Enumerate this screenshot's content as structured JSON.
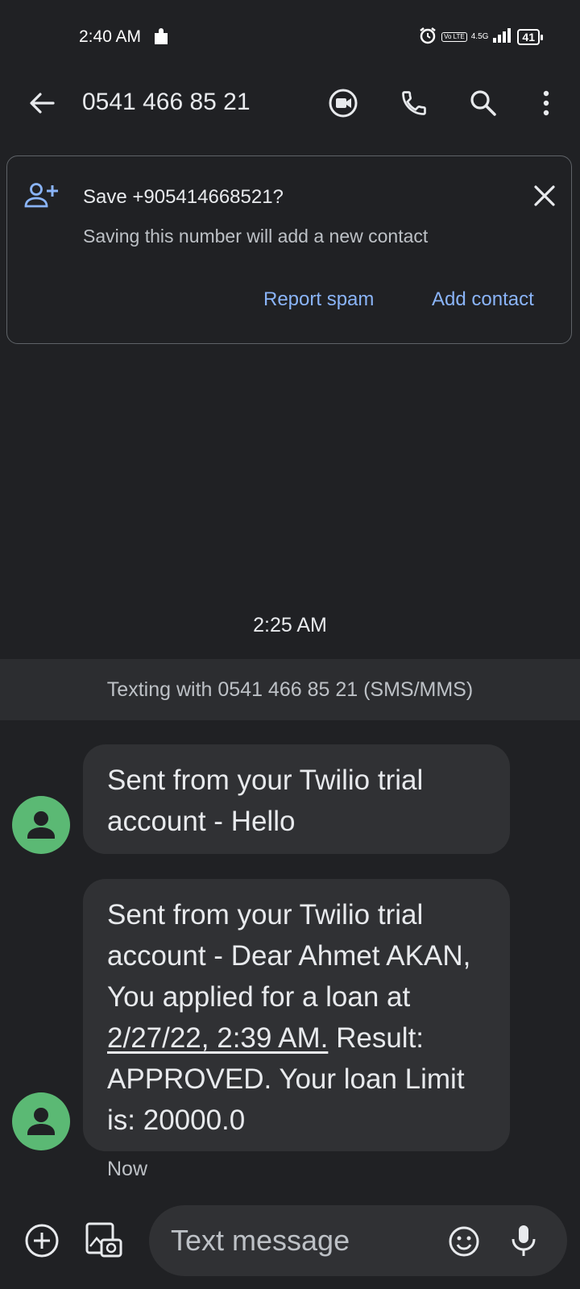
{
  "status_bar": {
    "time": "2:40 AM",
    "volte": "Vo LTE",
    "network": "4.5G",
    "battery": "41"
  },
  "app_bar": {
    "title": "0541 466 85 21"
  },
  "save_card": {
    "title": "Save +905414668521?",
    "subtitle": "Saving this number will add a new contact",
    "report_spam": "Report spam",
    "add_contact": "Add contact"
  },
  "conversation": {
    "time_header": "2:25 AM",
    "banner": "Texting with 0541 466 85 21 (SMS/MMS)",
    "messages": [
      {
        "text": "Sent from your Twilio trial account - Hello"
      },
      {
        "text_before": "Sent from your Twilio trial account - Dear Ahmet AKAN, You applied for a loan at ",
        "link": "2/27/22, 2:39 AM.",
        "text_after": " Result: APPROVED. Your loan Limit is: 20000.0"
      }
    ],
    "last_status": "Now"
  },
  "compose": {
    "placeholder": "Text message"
  },
  "colors": {
    "background": "#202124",
    "bubble": "#303134",
    "accent": "#8ab4f8",
    "avatar": "#5bb974"
  }
}
